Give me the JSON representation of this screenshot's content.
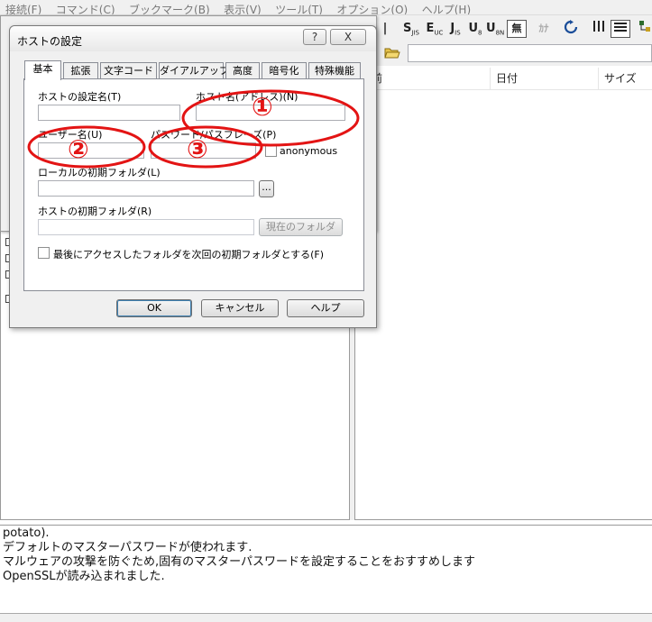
{
  "menubar": {
    "items": [
      "接続(F)",
      "コマンド(C)",
      "ブックマーク(B)",
      "表示(V)",
      "ツール(T)",
      "オプション(O)",
      "ヘルプ(H)"
    ]
  },
  "toolbar": {
    "buttons": [
      "S",
      "E",
      "J",
      "U",
      "U",
      "無",
      "ｶﾅ"
    ]
  },
  "remote_pane": {
    "columns": [
      "名前",
      "日付",
      "サイズ"
    ]
  },
  "dialog": {
    "title": "ホストの設定",
    "help_button": "?",
    "close_button": "X",
    "tabs": [
      "基本",
      "拡張",
      "文字コード",
      "ダイアルアップ",
      "高度",
      "暗号化",
      "特殊機能"
    ],
    "fields": {
      "host_setting_name": {
        "label": "ホストの設定名(T)",
        "value": ""
      },
      "host_name": {
        "label": "ホスト名(アドレス)(N)",
        "value": ""
      },
      "user_name": {
        "label": "ユーザー名(U)",
        "value": ""
      },
      "password": {
        "label": "パスワード/パスフレーズ(P)",
        "value": ""
      },
      "anonymous": {
        "label": "anonymous",
        "checked": false
      },
      "local_folder": {
        "label": "ローカルの初期フォルダ(L)",
        "value": "",
        "browse_label": "..."
      },
      "host_folder": {
        "label": "ホストの初期フォルダ(R)",
        "value": "",
        "current_folder_label": "現在のフォルダ"
      },
      "last_folder": {
        "label": "最後にアクセスしたフォルダを次回の初期フォルダとする(F)",
        "checked": false
      }
    },
    "buttons": {
      "ok": "OK",
      "cancel": "キャンセル",
      "help": "ヘルプ"
    },
    "annotations": [
      "①",
      "②",
      "③"
    ],
    "annotation_color": "#e31414"
  },
  "log": {
    "lines": [
      "potato).",
      "デフォルトのマスターパスワードが使われます.",
      "マルウェアの攻撃を防ぐため,固有のマスターパスワードを設定することをおすすめします",
      "OpenSSLが読み込まれました."
    ]
  }
}
